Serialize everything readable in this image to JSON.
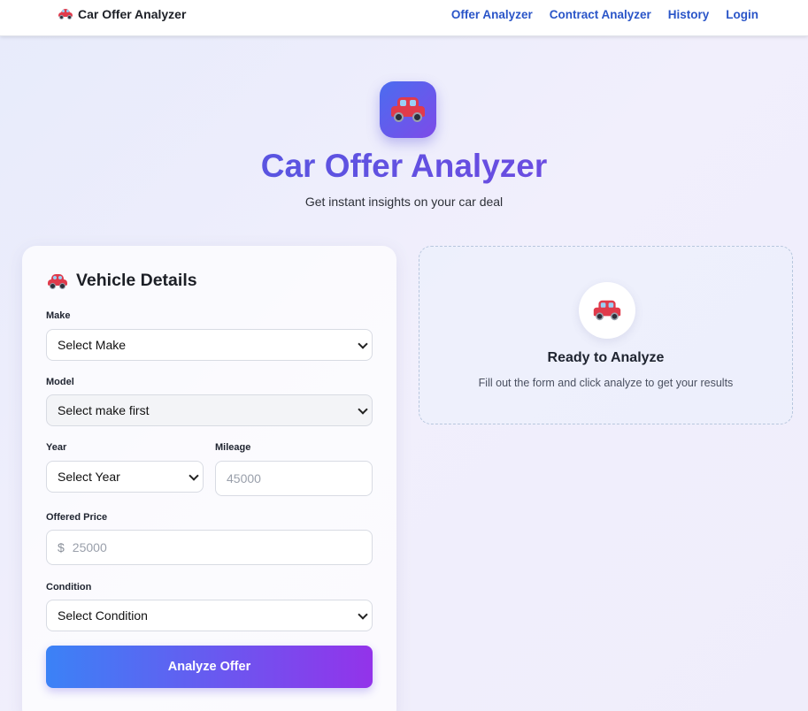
{
  "navbar": {
    "brand": "Car Offer Analyzer",
    "links": [
      "Offer Analyzer",
      "Contract Analyzer",
      "History",
      "Login"
    ]
  },
  "hero": {
    "title": "Car Offer Analyzer",
    "subtitle": "Get instant insights on your car deal"
  },
  "form": {
    "heading": "Vehicle Details",
    "make": {
      "label": "Make",
      "value": "Select Make"
    },
    "model": {
      "label": "Model",
      "value": "Select make first"
    },
    "year": {
      "label": "Year",
      "value": "Select Year"
    },
    "mileage": {
      "label": "Mileage",
      "placeholder": "45000"
    },
    "price": {
      "label": "Offered Price",
      "prefix": "$",
      "placeholder": "25000"
    },
    "condition": {
      "label": "Condition",
      "value": "Select Condition"
    },
    "submit_label": "Analyze Offer"
  },
  "results": {
    "title": "Ready to Analyze",
    "subtitle": "Fill out the form and click analyze to get your results"
  },
  "colors": {
    "accent_start": "#3b82f6",
    "accent_end": "#9333ea",
    "nav_link": "#2a55c8"
  },
  "icons": [
    "car-icon",
    "chevron-down-icon"
  ]
}
